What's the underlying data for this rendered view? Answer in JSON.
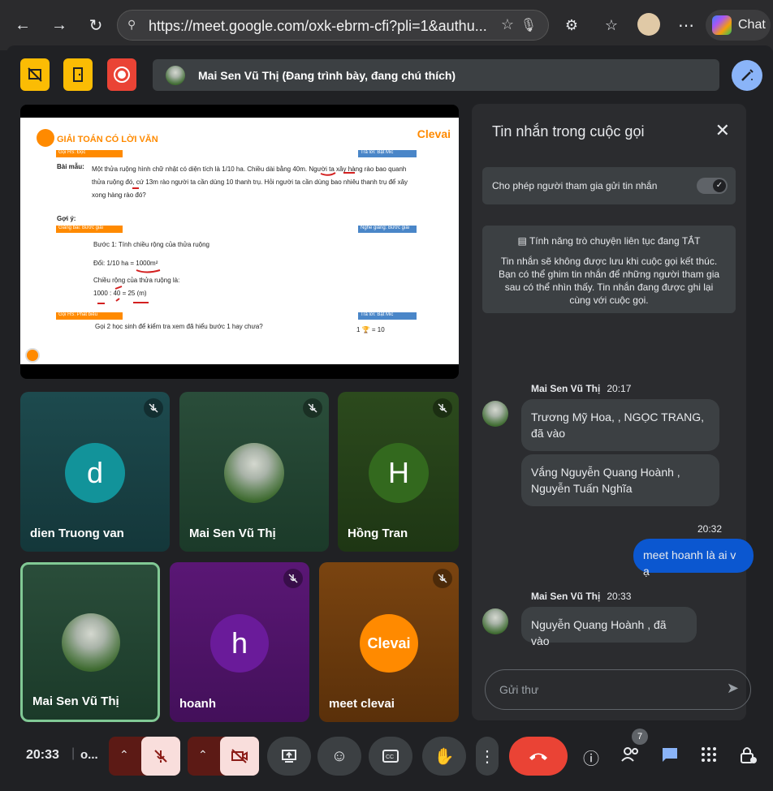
{
  "browser": {
    "url": "https://meet.google.com/oxk-ebrm-cfi?pli=1&authu...",
    "chat_label": "Chat"
  },
  "presentation": {
    "presenter": "Mai Sen Vũ Thị (Đang trình bày, đang chú thích)",
    "slide": {
      "title": "GIẢI TOÁN CÓ LỜI VĂN",
      "brand": "Clevai",
      "tag1_left": "Gọi HS: Đọc",
      "tag1_right": "Trả lời: Bật Mic",
      "sample_label": "Bài mẫu:",
      "problem": "Một thửa ruộng hình chữ nhật có diện tích là 1/10 ha. Chiều dài bằng 40m. Người ta xây hàng rào bao quanh thửa ruộng đó, cứ 13m rào người ta cần dùng 10 thanh trụ. Hỏi người ta cần dùng bao nhiêu thanh trụ để xây xong hàng rào đó?",
      "hint_label": "Gợi ý:",
      "tag2_left": "Giảng bài: Bước giải",
      "tag2_right": "Nghe giảng: Bước giải",
      "step1": "Bước 1: Tính chiều rộng của thửa ruộng",
      "convert": "Đổi: 1/10 ha = 1000m²",
      "width_label": "Chiều rộng của thửa ruộng là:",
      "calc": "1000 : 40 = 25 (m)",
      "tag3_left": "Gọi HS: Phát biểu",
      "tag3_right": "Trả lời: Bật Mic",
      "question": "Gọi 2 học sinh để kiểm tra xem đã hiểu bước 1 hay chưa?",
      "reward": "1 🏆 = 10"
    }
  },
  "participants": [
    {
      "name": "dien Truong van",
      "initial": "d",
      "color": "#12939a"
    },
    {
      "name": "Mai Sen Vũ Thị",
      "initial": "",
      "color": ""
    },
    {
      "name": "Hồng Tran",
      "initial": "H",
      "color": "#33691e"
    },
    {
      "name": "Mai Sen Vũ Thị",
      "initial": "",
      "color": ""
    },
    {
      "name": "hoanh",
      "initial": "h",
      "color": "#6a1b9a"
    },
    {
      "name": "meet clevai",
      "initial": "Clevai",
      "color": "#ff8a00"
    }
  ],
  "chat": {
    "title": "Tin nhắn trong cuộc gọi",
    "allow_label": "Cho phép người tham gia gửi tin nhắn",
    "info_title": "Tính năng trò chuyện liên tục đang TẮT",
    "info_body": "Tin nhắn sẽ không được lưu khi cuộc gọi kết thúc. Bạn có thể ghim tin nhắn để những người tham gia sau có thể nhìn thấy. Tin nhắn đang được ghi lại cùng với cuộc gọi.",
    "messages": [
      {
        "sender": "Mai Sen Vũ Thị",
        "time": "20:17",
        "texts": [
          "Trương Mỹ Hoa, , NGỌC TRANG, đã vào",
          "Vắng Nguyễn Quang Hoành , Nguyễn Tuấn Nghĩa"
        ]
      },
      {
        "sender": "",
        "time": "20:32",
        "texts": [
          "meet hoanh là ai v ạ"
        ]
      },
      {
        "sender": "Mai Sen Vũ Thị",
        "time": "20:33",
        "texts": [
          "Nguyễn Quang Hoành , đã vào"
        ]
      }
    ],
    "input_placeholder": "Gửi thư"
  },
  "controls": {
    "clock": "20:33",
    "meeting_code": "o...",
    "people_count": "7"
  },
  "colors": {
    "accent": "#8ab4f8",
    "hangup": "#ea4335",
    "mic_off_bg": "#f9dedc",
    "self_bubble": "#0b57d0",
    "highlight_border": "#81c995"
  }
}
